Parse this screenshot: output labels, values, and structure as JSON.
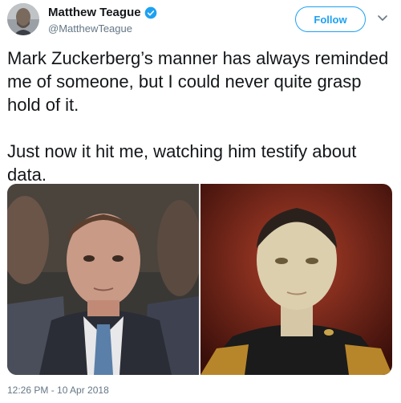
{
  "user": {
    "display_name": "Matthew Teague",
    "handle": "@MatthewTeague",
    "verified": true
  },
  "follow_button": {
    "label": "Follow"
  },
  "tweet": {
    "text": "Mark Zuckerberg’s manner has always reminded me of someone, but I could never quite grasp hold of it.\n\nJust now it hit me, watching him testify about data.",
    "timestamp": "12:26 PM - 10 Apr 2018"
  },
  "colors": {
    "accent": "#1da1f2",
    "secondary_text": "#657786",
    "primary_text": "#14171a"
  },
  "icons": {
    "verified": "verified-badge-icon",
    "more": "chevron-down-icon"
  }
}
